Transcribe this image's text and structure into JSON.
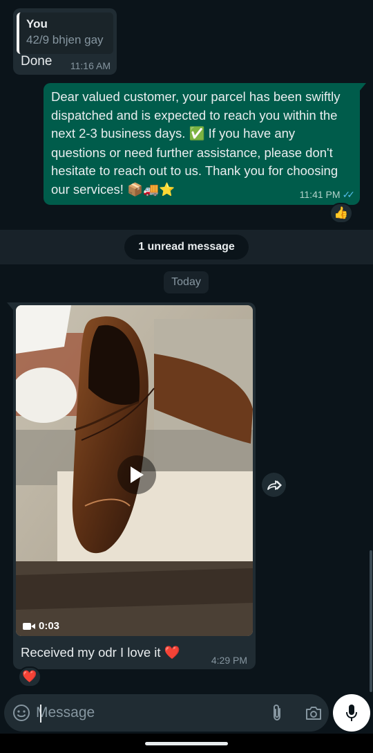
{
  "messages": {
    "quoted_reply": {
      "quote_author": "You",
      "quote_text": "42/9 bhjen gay",
      "text": "Done",
      "time": "11:16 AM"
    },
    "outgoing": {
      "text_before_emoji": "Dear valued customer, your parcel has been swiftly dispatched and is expected to reach you within the next 2-3 business days. ",
      "emoji_check": "✅",
      "text_after_emoji": " If you have any questions or need further assistance, please don't hesitate to reach out to us. Thank you for choosing our services! ",
      "emoji_end": "📦🚚⭐",
      "time": "11:41 PM",
      "ticks": "✓✓",
      "reaction": "👍"
    },
    "unread_banner": "1 unread message",
    "date_divider": "Today",
    "video_message": {
      "duration": "0:03",
      "caption_text": "Received my odr I love it ",
      "caption_emoji": "❤️",
      "time": "4:29 PM",
      "reaction": "❤️"
    }
  },
  "composer": {
    "placeholder": "Message"
  },
  "colors": {
    "background": "#0b141a",
    "incoming_bubble": "#202c33",
    "outgoing_bubble": "#005c4b",
    "read_ticks": "#53bdeb"
  },
  "icons": [
    "emoji-icon",
    "attach-icon",
    "camera-icon",
    "mic-icon",
    "forward-icon",
    "play-icon",
    "video-camera-icon"
  ]
}
